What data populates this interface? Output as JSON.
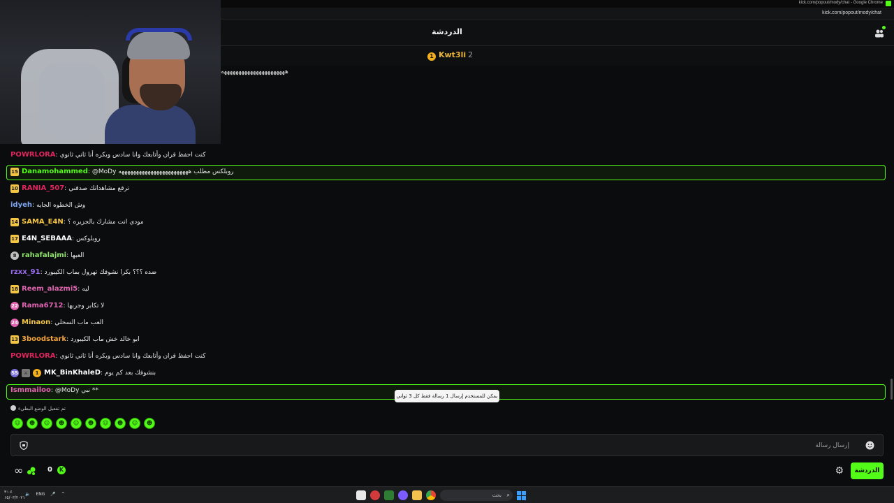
{
  "browser": {
    "window_title": "kick.com/popout/mody/chat - Google Chrome",
    "url": "kick.com/popout/mody/chat"
  },
  "header": {
    "title": "الدردشة"
  },
  "pinned": {
    "username": "Kwt3li",
    "count": "2",
    "badge": "1",
    "message": "ههههههههههههههههههههههه"
  },
  "messages": [
    {
      "user": "POWRLORA",
      "color": "#e0245e",
      "badges": [],
      "text": "كنت احفظ قران وأتابعك وانا سادس وبكره أنا ثاني ثانوي",
      "highlight": false
    },
    {
      "user": "Danamohammed",
      "color": "#53fc18",
      "badges": [
        {
          "type": "yellow",
          "label": "15"
        }
      ],
      "text": "@MoDy روبلكس مطلب ههههههههههههههههههههههههه",
      "highlight": true
    },
    {
      "user": "RANIA_507",
      "color": "#e0245e",
      "badges": [
        {
          "type": "yellow",
          "label": "10"
        }
      ],
      "text": "ترقع مشاهداتك صدقني",
      "highlight": false
    },
    {
      "user": "idyeh",
      "color": "#7ea6f2",
      "badges": [],
      "text": "وش الخطوه الجايه",
      "highlight": false
    },
    {
      "user": "SAMA_E4N",
      "color": "#f4c542",
      "badges": [
        {
          "type": "yellow",
          "label": "14"
        }
      ],
      "text": "مودي انت مشارك بالجزيره ؟",
      "highlight": false
    },
    {
      "user": "E4N_SEBAAA",
      "color": "#ffffff",
      "badges": [
        {
          "type": "yellow",
          "label": "17"
        }
      ],
      "text": "روبلوكس",
      "highlight": false
    },
    {
      "user": "rahafalajmi",
      "color": "#8fe36a",
      "badges": [
        {
          "type": "gray",
          "label": "8"
        }
      ],
      "text": "العبها",
      "highlight": false
    },
    {
      "user": "rzxx_91",
      "color": "#9b6cf0",
      "badges": [],
      "text": "ضده ؟؟؟ بكرا نشوفك تهرول بماب الكيبورد",
      "highlight": false
    },
    {
      "user": "Reem_alazmi5",
      "color": "#e064b0",
      "badges": [
        {
          "type": "yellow",
          "label": "18"
        }
      ],
      "text": "ليه",
      "highlight": false
    },
    {
      "user": "Rama6712",
      "color": "#e064b0",
      "badges": [
        {
          "type": "pink",
          "label": "22"
        }
      ],
      "text": "لا تكابر وجربها",
      "highlight": false
    },
    {
      "user": "Minaon",
      "color": "#f4c542",
      "badges": [
        {
          "type": "pink",
          "label": "24"
        }
      ],
      "text": "العب ماب السحلي",
      "highlight": false
    },
    {
      "user": "3boodstark",
      "color": "#f2a33a",
      "badges": [
        {
          "type": "yellow",
          "label": "13"
        }
      ],
      "text": "ابو خالد خش ماب الكيبورد",
      "highlight": false
    },
    {
      "user": "POWRLORA",
      "color": "#e0245e",
      "badges": [],
      "text": "كنت احفظ قران وأتابعك وانا سادس وبكره أنا ثاني ثانوي",
      "highlight": false
    },
    {
      "user": "MK_BinKhaleD",
      "color": "#ffffff",
      "badges": [
        {
          "type": "purple",
          "label": "SS"
        },
        {
          "type": "bot",
          "label": "⚔"
        },
        {
          "type": "gold",
          "label": "1"
        }
      ],
      "text": "بنشوفك بعد كم يوم",
      "highlight": false
    },
    {
      "user": "Ismmailoo",
      "color": "#e064b0",
      "badges": [],
      "text": "@MoDy نبي **",
      "highlight": true
    }
  ],
  "toast": {
    "text": "يمكن للمستخدم إرسال 1 رسالة فقط كل 3 ثواني"
  },
  "slowmode": {
    "text": "تم تفعيل الوضع البطيء"
  },
  "emotes": [
    "emote-1",
    "emote-2",
    "emote-3",
    "emote-4",
    "emote-5",
    "emote-6",
    "emote-7",
    "emote-8",
    "emote-9",
    "emote-10"
  ],
  "input": {
    "placeholder": "إرسال رسالة"
  },
  "footer": {
    "points": "0",
    "chat_button": "الدردشة"
  },
  "taskbar": {
    "time": "٣:٠٤",
    "date": "١٥/٠٣/٢٠٢١",
    "lang": "ENG",
    "search_placeholder": "بحث"
  },
  "colors": {
    "accent": "#53fc18",
    "background": "#0b0c0d"
  }
}
